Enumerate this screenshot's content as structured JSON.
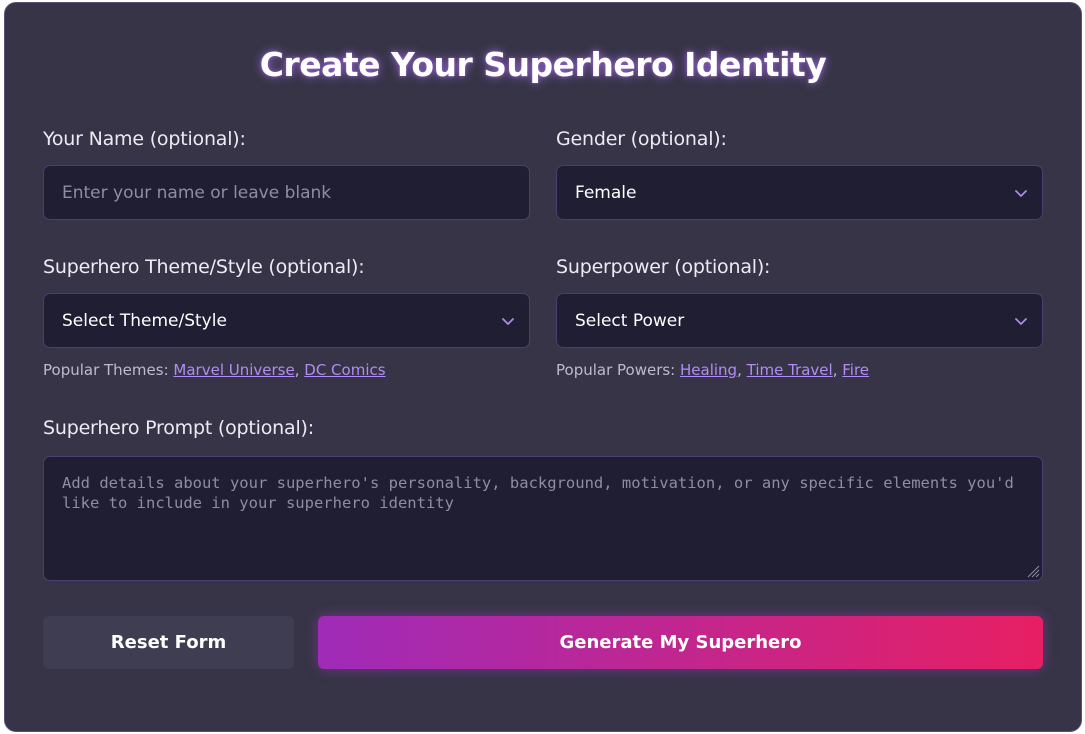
{
  "form": {
    "title": "Create Your Superhero Identity",
    "name": {
      "label": "Your Name (optional):",
      "placeholder": "Enter your name or leave blank",
      "value": ""
    },
    "gender": {
      "label": "Gender (optional):",
      "selected": "Female",
      "icon": "chevron-down-icon"
    },
    "theme": {
      "label": "Superhero Theme/Style (optional):",
      "selected": "Select Theme/Style",
      "icon": "chevron-down-icon",
      "popular_label": "Popular Themes:",
      "popular": [
        "Marvel Universe",
        "DC Comics"
      ]
    },
    "power": {
      "label": "Superpower (optional):",
      "selected": "Select Power",
      "icon": "chevron-down-icon",
      "popular_label": "Popular Powers:",
      "popular": [
        "Healing",
        "Time Travel",
        "Fire"
      ]
    },
    "prompt": {
      "label": "Superhero Prompt (optional):",
      "placeholder": "Add details about your superhero's personality, background, motivation, or any specific elements you'd like to include in your superhero identity",
      "value": ""
    },
    "buttons": {
      "reset": "Reset Form",
      "generate": "Generate My Superhero"
    }
  },
  "colors": {
    "card_bg": "#363446",
    "field_bg": "#1f1e33",
    "field_border": "#4a3f73",
    "link": "#b18cf5",
    "accent_chevron": "#a98be8",
    "gradient_start": "#9f2bb8",
    "gradient_end": "#e71f63",
    "reset_bg": "#3e3d52"
  }
}
